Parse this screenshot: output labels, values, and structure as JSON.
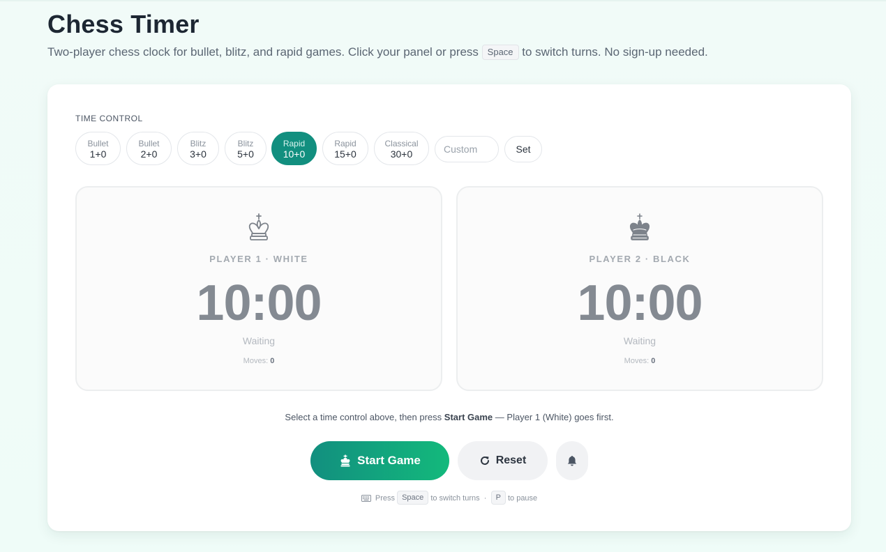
{
  "page": {
    "title": "Chess Timer",
    "subtitle_before": "Two-player chess clock for bullet, blitz, and rapid games. Click your panel or press",
    "subtitle_key": "Space",
    "subtitle_after": "to switch turns. No sign-up needed."
  },
  "time_control": {
    "label": "TIME CONTROL",
    "presets": [
      {
        "type": "Bullet",
        "time": "1+0",
        "active": false
      },
      {
        "type": "Bullet",
        "time": "2+0",
        "active": false
      },
      {
        "type": "Blitz",
        "time": "3+0",
        "active": false
      },
      {
        "type": "Blitz",
        "time": "5+0",
        "active": false
      },
      {
        "type": "Rapid",
        "time": "10+0",
        "active": true
      },
      {
        "type": "Rapid",
        "time": "15+0",
        "active": false
      },
      {
        "type": "Classical",
        "time": "30+0",
        "active": false
      }
    ],
    "custom_placeholder": "Custom",
    "custom_value": "",
    "set_label": "Set"
  },
  "players": [
    {
      "icon": "white-king-icon",
      "name": "PLAYER 1 · WHITE",
      "time": "10:00",
      "status": "Waiting",
      "moves_label": "Moves:",
      "moves": "0"
    },
    {
      "icon": "black-king-icon",
      "name": "PLAYER 2 · BLACK",
      "time": "10:00",
      "status": "Waiting",
      "moves_label": "Moves:",
      "moves": "0"
    }
  ],
  "hint": {
    "before": "Select a time control above, then press",
    "bold": "Start Game",
    "after": "— Player 1 (White) goes first."
  },
  "actions": {
    "start_label": "Start Game",
    "start_icon": "king-icon",
    "reset_label": "Reset",
    "reset_icon": "refresh-icon",
    "sound_icon": "bell-icon"
  },
  "shortcuts": {
    "press": "Press",
    "space_key": "Space",
    "switch_text": "to switch turns",
    "separator": "·",
    "pause_key": "P",
    "pause_text": "to pause"
  },
  "colors": {
    "accent": "#128f7f",
    "accent_gradient_end": "#13b97c",
    "background": "#effcf8"
  }
}
